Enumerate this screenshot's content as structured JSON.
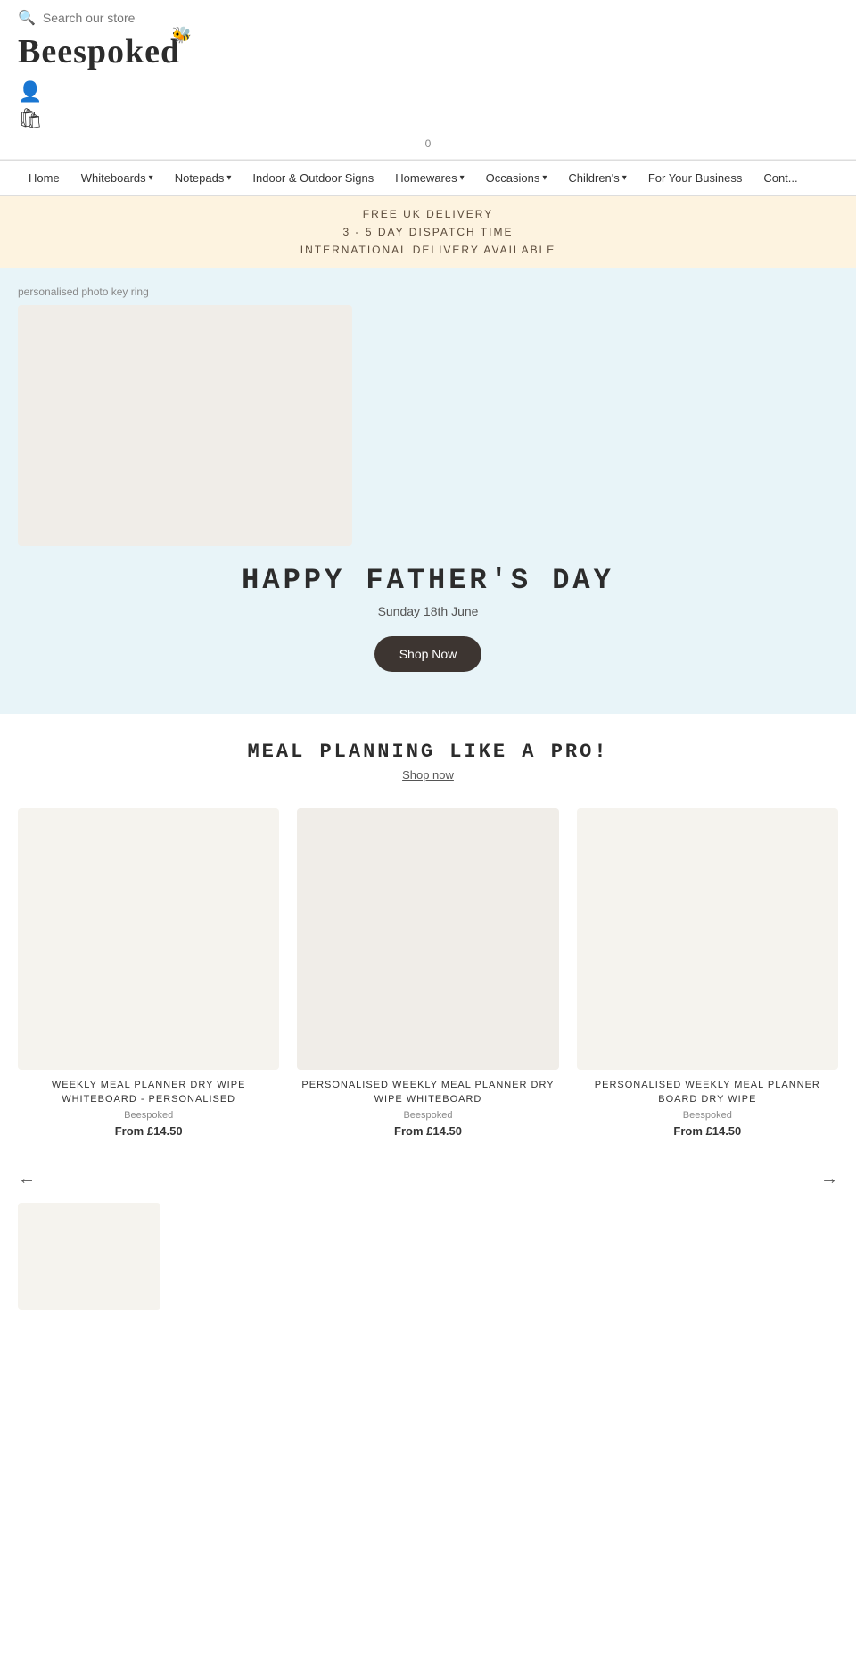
{
  "header": {
    "search_placeholder": "Search our store",
    "logo": "Beespoked",
    "account_icon": "👤",
    "bag_icon": "🛍",
    "cart_count": "0"
  },
  "nav": {
    "items": [
      {
        "label": "Home",
        "has_dropdown": false
      },
      {
        "label": "Whiteboards",
        "has_dropdown": true
      },
      {
        "label": "Notepads",
        "has_dropdown": true
      },
      {
        "label": "Indoor & Outdoor Signs",
        "has_dropdown": false
      },
      {
        "label": "Homewares",
        "has_dropdown": true
      },
      {
        "label": "Occasions",
        "has_dropdown": true
      },
      {
        "label": "Children's",
        "has_dropdown": true
      },
      {
        "label": "For Your Business",
        "has_dropdown": false
      },
      {
        "label": "Cont...",
        "has_dropdown": false
      }
    ]
  },
  "banner": {
    "line1": "FREE UK DELIVERY",
    "line2": "3 - 5 DAY DISPATCH TIME",
    "line3": "INTERNATIONAL DELIVERY AVAILABLE"
  },
  "hero": {
    "image_label": "personalised photo key ring",
    "title": "HAPPY FATHER'S DAY",
    "subtitle": "Sunday 18th June",
    "cta_label": "Shop Now"
  },
  "meal_section": {
    "title": "MEAL PLANNING LIKE A PRO!",
    "link_label": "Shop now"
  },
  "products": [
    {
      "name": "WEEKLY MEAL PLANNER DRY WIPE WHITEBOARD - PERSONALISED",
      "brand": "Beespoked",
      "price_prefix": "From",
      "price": "£14.50"
    },
    {
      "name": "PERSONALISED WEEKLY MEAL PLANNER DRY WIPE WHITEBOARD",
      "brand": "Beespoked",
      "price_prefix": "From",
      "price": "£14.50"
    },
    {
      "name": "PERSONALISED WEEKLY MEAL PLANNER BOARD DRY WIPE",
      "brand": "Beespoked",
      "price_prefix": "From",
      "price": "£14.50"
    }
  ],
  "carousel": {
    "prev_label": "←",
    "next_label": "→"
  },
  "extra_product": {
    "name": "",
    "brand": "",
    "price": ""
  }
}
